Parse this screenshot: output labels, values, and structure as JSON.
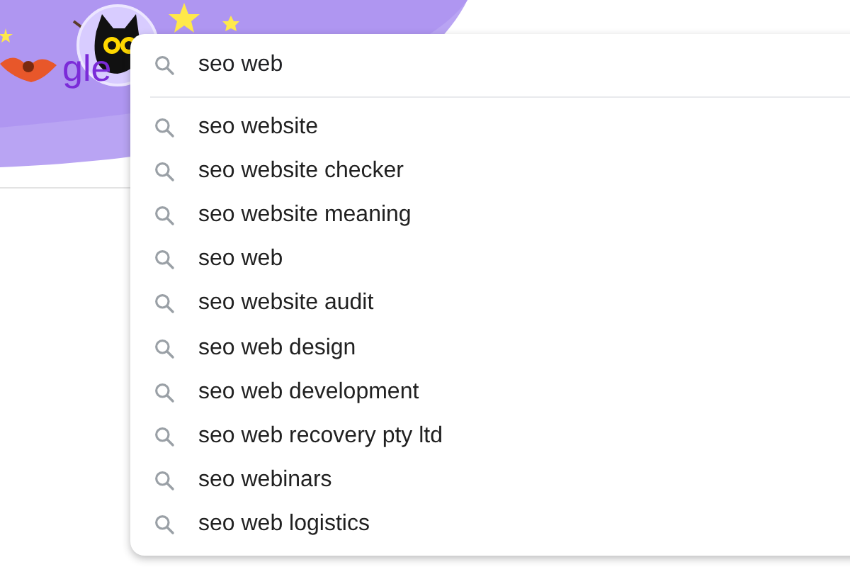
{
  "doodle": {
    "logo_text": "gle"
  },
  "search": {
    "value": "seo web"
  },
  "suggestions": [
    {
      "text": "seo website"
    },
    {
      "text": "seo website checker"
    },
    {
      "text": "seo website meaning"
    },
    {
      "text": "seo web"
    },
    {
      "text": "seo website audit"
    },
    {
      "text": "seo web design"
    },
    {
      "text": "seo web development"
    },
    {
      "text": "seo web recovery pty ltd"
    },
    {
      "text": "seo webinars"
    },
    {
      "text": "seo web logistics"
    }
  ]
}
